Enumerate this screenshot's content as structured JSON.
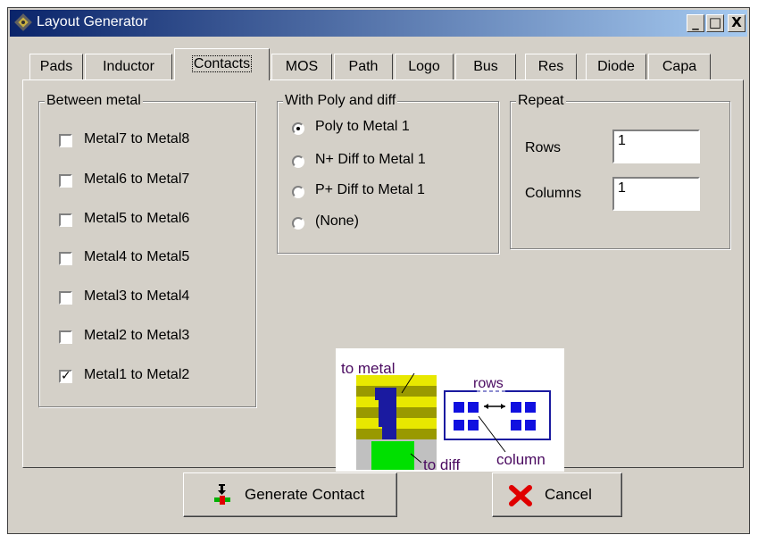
{
  "window": {
    "title": "Layout Generator",
    "controls": {
      "minimize": "_",
      "maximize": "□",
      "close": "X"
    }
  },
  "tabs": [
    {
      "label": "Pads"
    },
    {
      "label": "Inductor"
    },
    {
      "label": "Contacts",
      "active": true
    },
    {
      "label": "MOS"
    },
    {
      "label": "Path"
    },
    {
      "label": "Logo"
    },
    {
      "label": "Bus"
    },
    {
      "label": "Res"
    },
    {
      "label": "Diode"
    },
    {
      "label": "Capa"
    }
  ],
  "between_metal": {
    "legend": "Between metal",
    "items": [
      {
        "label": "Metal7 to Metal8",
        "checked": false
      },
      {
        "label": "Metal6 to Metal7",
        "checked": false
      },
      {
        "label": "Metal5 to Metal6",
        "checked": false
      },
      {
        "label": "Metal4 to Metal5",
        "checked": false
      },
      {
        "label": "Metal3 to Metal4",
        "checked": false
      },
      {
        "label": "Metal2 to Metal3",
        "checked": false
      },
      {
        "label": "Metal1 to Metal2",
        "checked": true
      }
    ]
  },
  "poly_diff": {
    "legend": "With Poly and diff",
    "options": [
      {
        "label": "Poly to Metal 1",
        "selected": true
      },
      {
        "label": "N+ Diff to Metal 1",
        "selected": false
      },
      {
        "label": "P+ Diff to Metal 1",
        "selected": false
      },
      {
        "label": "(None)",
        "selected": false
      }
    ]
  },
  "repeat": {
    "legend": "Repeat",
    "rows_label": "Rows",
    "rows_value": "1",
    "columns_label": "Columns",
    "columns_value": "1"
  },
  "diagram": {
    "to_metal": "to metal",
    "rows": "rows",
    "to_diff": "to diff",
    "column": "column"
  },
  "buttons": {
    "generate": "Generate Contact",
    "cancel": "Cancel"
  },
  "colors": {
    "face": "#d4d0c8",
    "title_start": "#0a246a",
    "title_end": "#a6caf0",
    "metal": "#e8e800",
    "poly": "#999900",
    "via": "#1a1aa0",
    "contact": "#1010e0",
    "diff": "#00e000",
    "label": "#4a0a60"
  }
}
